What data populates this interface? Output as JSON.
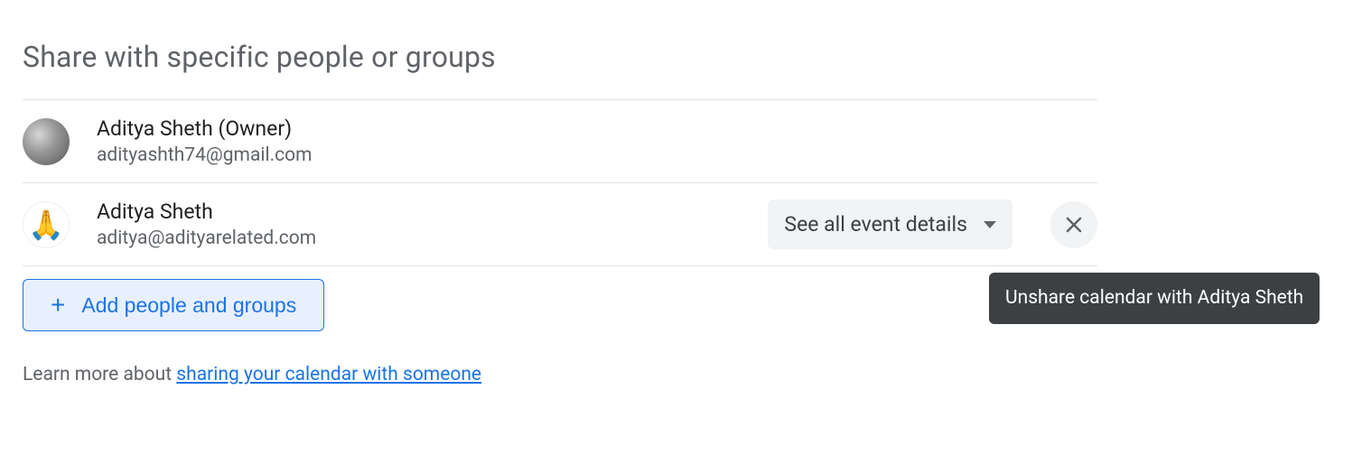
{
  "section": {
    "title": "Share with specific people or groups"
  },
  "people": [
    {
      "name": "Aditya Sheth (Owner)",
      "email": "adityashth74@gmail.com"
    },
    {
      "name": "Aditya Sheth",
      "email": "aditya@adityarelated.com",
      "permission": "See all event details"
    }
  ],
  "add_button": {
    "label": "Add people and groups"
  },
  "learn_more": {
    "prefix": "Learn more about ",
    "link_text": "sharing your calendar with someone"
  },
  "tooltip": {
    "text": "Unshare calendar with Aditya Sheth"
  },
  "avatar_hands_emoji": "🙏"
}
